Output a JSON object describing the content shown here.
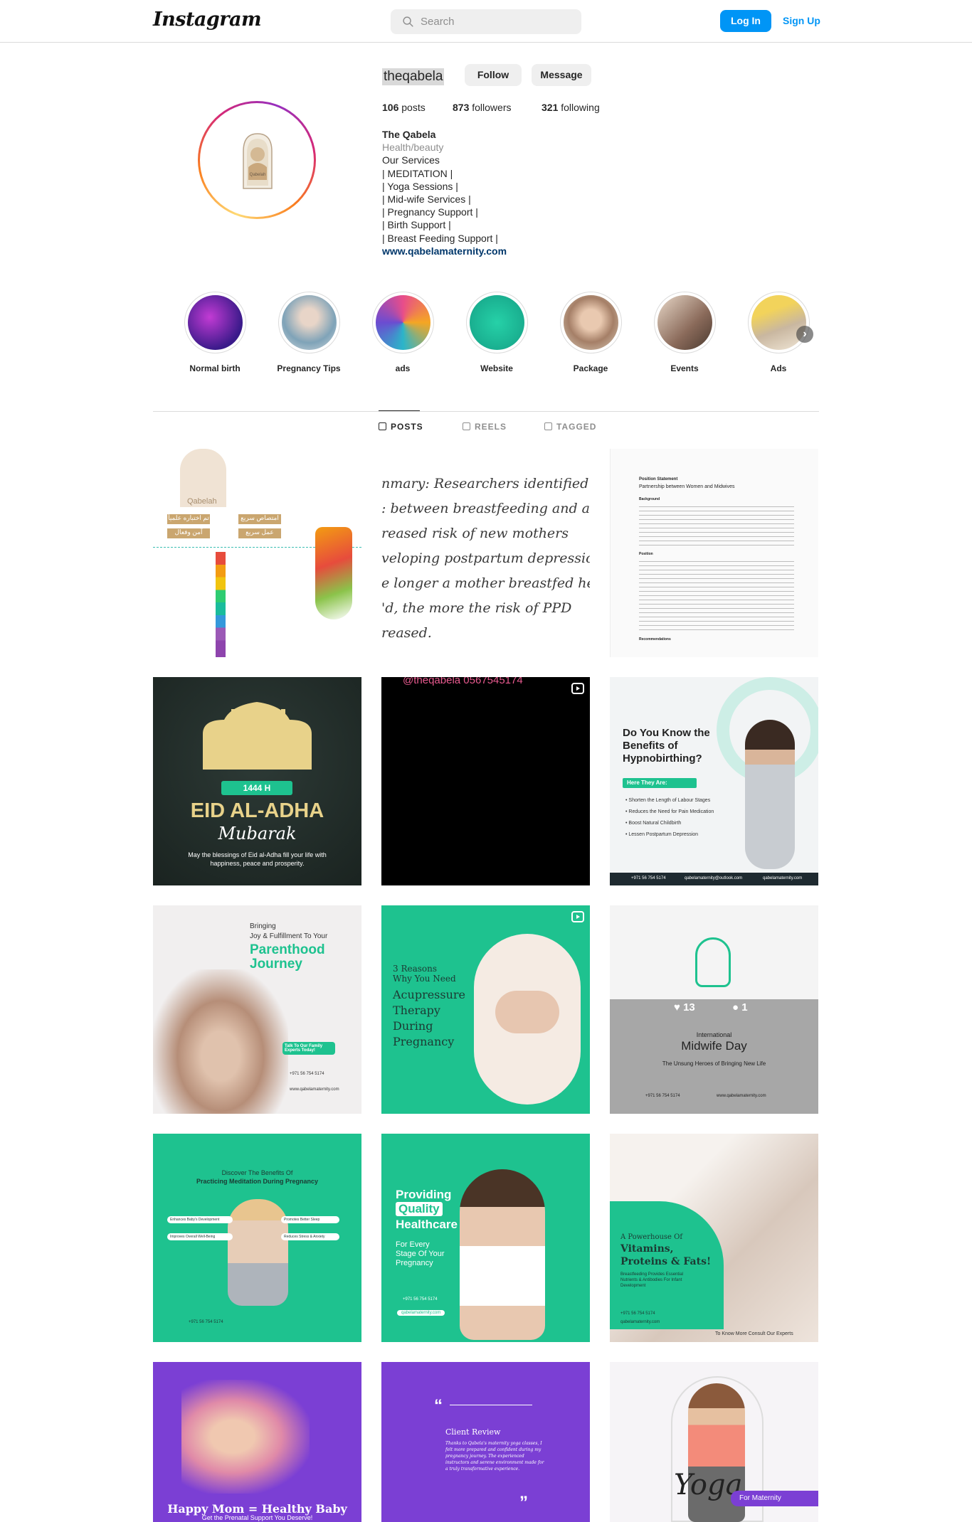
{
  "header": {
    "logo": "Instagram",
    "search_placeholder": "Search",
    "login_label": "Log In",
    "signup_label": "Sign Up"
  },
  "profile": {
    "username": "theqabela",
    "follow_label": "Follow",
    "message_label": "Message",
    "posts_count": "106",
    "posts_label": " posts",
    "followers_count": "873",
    "followers_label": " followers",
    "following_count": "321",
    "following_label": " following",
    "name": "The Qabela",
    "category": "Health/beauty",
    "bio_lines": [
      "Our Services",
      "| MEDITATION |",
      "| Yoga Sessions |",
      "| Mid-wife Services |",
      "| Pregnancy Support |",
      "| Birth Support |",
      "| Breast Feeding Support |"
    ],
    "website": "www.qabelamaternity.com",
    "avatar_text": "Qabelah"
  },
  "highlights": [
    {
      "label": "Normal birth",
      "color1": "#3a1a8a",
      "color2": "#c23bd4"
    },
    {
      "label": "Pregnancy Tips",
      "color1": "#cfd8dc",
      "color2": "#7fa3b8"
    },
    {
      "label": "ads",
      "color1": "#e84d8a",
      "color2": "#2bb5c9"
    },
    {
      "label": "Website",
      "color1": "#1bbc9b",
      "color2": "#14a085"
    },
    {
      "label": "Package",
      "color1": "#d8cbb8",
      "color2": "#a57f67"
    },
    {
      "label": "Events",
      "color1": "#8a6a5a",
      "color2": "#e8d8c8"
    },
    {
      "label": "Ads",
      "color1": "#f2d35b",
      "color2": "#c9b7a0"
    }
  ],
  "tabs": {
    "posts": "POSTS",
    "reels": "REELS",
    "tagged": "TAGGED"
  },
  "posts": {
    "p1": {
      "tag": "Qabelah",
      "btn1": "تم اختباره علمياً",
      "btn2": "امتصاص سريع",
      "btn3": "آمن وفعال",
      "btn4": "عمل سريع"
    },
    "p2": {
      "lines": [
        "nmary: Researchers identified a",
        ": between breastfeeding and a",
        "reased risk of new mothers",
        "veloping postpartum depression.",
        "e longer a mother breastfed her",
        "'d, the more the risk of PPD",
        "reased."
      ],
      "bold": "nmary:"
    },
    "p3": {
      "title": "Position Statement",
      "subtitle": "Partnership between Women and Midwives",
      "h1": "Background",
      "h2": "Position",
      "h3": "Recommendations"
    },
    "p4": {
      "badge": "1444 H",
      "title": "EID AL-ADHA",
      "script": "Mubarak",
      "caption": "May the blessings of Eid al-Adha fill your life with happiness, peace and prosperity."
    },
    "p5": {
      "overlay": "@theqabela  0567545174"
    },
    "p6": {
      "title": "Do You Know the Benefits of Hypnobirthing?",
      "pill": "Here They Are:",
      "items": [
        "• Shorten the Length of Labour Stages",
        "• Reduces the Need for Pain Medication",
        "• Boost Natural Childbirth",
        "• Lessen Postpartum Depression"
      ],
      "footer1": "+971 56 754 5174",
      "footer2": "qabelamaternity@outlook.com",
      "footer3": "qabelamaternity.com"
    },
    "p7": {
      "l1": "Bringing",
      "l2": "Joy & Fulfillment To Your",
      "l3": "Parenthood",
      "l4": "Journey",
      "cta": "Talk To Our Family Experts Today!",
      "contact1": "+971 56 754 5174",
      "contact2": "www.qabelamaternity.com"
    },
    "p8": {
      "l1": "3 Reasons",
      "l2": "Why You Need",
      "l3": "Acupressure",
      "l4": "Therapy",
      "l5": "During",
      "l6": "Pregnancy"
    },
    "p9": {
      "likes": "13",
      "comments": "1",
      "small": "International",
      "title": "Midwife Day",
      "sub": "The Unsung Heroes of Bringing New Life",
      "contact1": "+971 56 754 5174",
      "contact2": "www.qabelamaternity.com"
    },
    "p10": {
      "l1": "Discover The Benefits Of",
      "l2": "Practicing Meditation During Pregnancy",
      "b1": "Enhances Baby's Development",
      "b2": "Promotes Better Sleep",
      "b3": "Improves Overall Well-Being",
      "b4": "Reduces Stress & Anxiety",
      "contact": "+971 56 754 5174"
    },
    "p11": {
      "l1": "Providing",
      "l2": "Quality",
      "l3": "Healthcare",
      "l4": "For Every",
      "l5": "Stage Of Your",
      "l6": "Pregnancy",
      "contact": "+971 56 754 5174",
      "web": "qabelamaternity.com"
    },
    "p12": {
      "l1": "A Powerhouse Of",
      "l2": "Vitamins,",
      "l3": "Proteins & Fats!",
      "l4": "Breastfeeding Provides Essential Nutrients & Antibodies For Infant Development",
      "cta": "To Know More Consult Our Experts",
      "contact": "+971 56 754 5174",
      "web": "qabelamaternity.com"
    },
    "p13": {
      "title": "Happy Mom = Healthy Baby",
      "sub": "Get the Prenatal Support You Deserve!"
    },
    "p14": {
      "title": "Client Review",
      "quote": "Thanks to Qabela's maternity yoga classes, I felt more prepared and confident during my pregnancy journey. The experienced instructors and serene environment made for a truly transformative experience."
    },
    "p15": {
      "script": "Yoga",
      "pill": "For Maternity"
    }
  },
  "colors": {
    "accent": "#0095f6",
    "green": "#1ec28f",
    "purple": "#7b3fd4",
    "gold": "#e8d28a"
  }
}
